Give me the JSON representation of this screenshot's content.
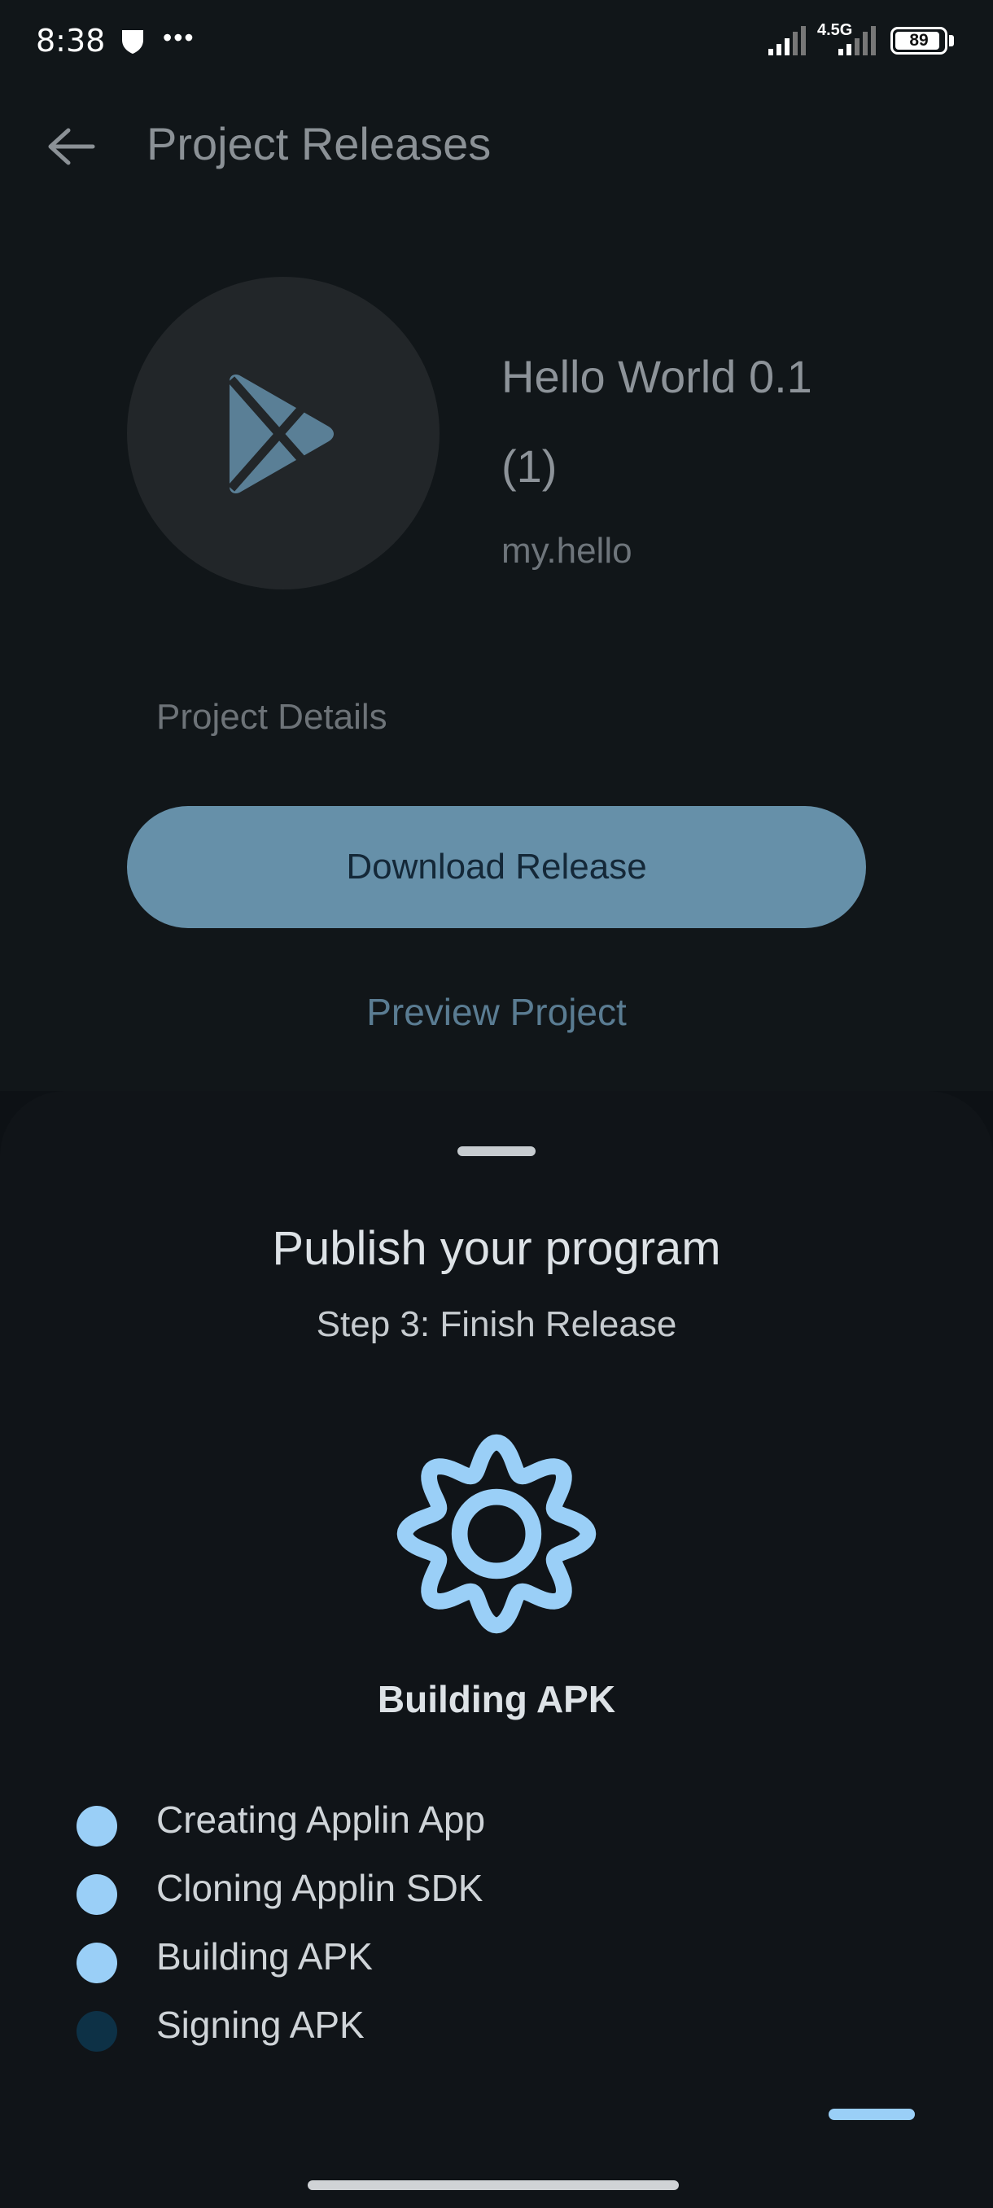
{
  "status_bar": {
    "time": "8:38",
    "network_label": "4.5G",
    "battery_level": "89",
    "icons": [
      "shield-notification-icon",
      "more-dots-icon",
      "signal-icon",
      "signal-icon",
      "battery-icon"
    ]
  },
  "app_bar": {
    "back_icon": "arrow-left-icon",
    "title": "Project Releases"
  },
  "project": {
    "icon": "play-store-icon",
    "name": "Hello World 0.1 (1)",
    "package": "my.hello",
    "details_link": "Project Details",
    "download_button": "Download Release",
    "preview_link": "Preview Project"
  },
  "sheet": {
    "title": "Publish your program",
    "subtitle": "Step 3: Finish Release",
    "status_icon": "gear-icon",
    "status_label": "Building APK",
    "steps": [
      {
        "label": "Creating Applin App",
        "done": true
      },
      {
        "label": "Cloning Applin SDK",
        "done": true
      },
      {
        "label": "Building APK",
        "done": true
      },
      {
        "label": "Signing APK",
        "done": false
      }
    ]
  },
  "colors": {
    "accent": "#9acff7",
    "button": "#6690a9",
    "background": "#101418",
    "pending_step": "#0d3146"
  }
}
